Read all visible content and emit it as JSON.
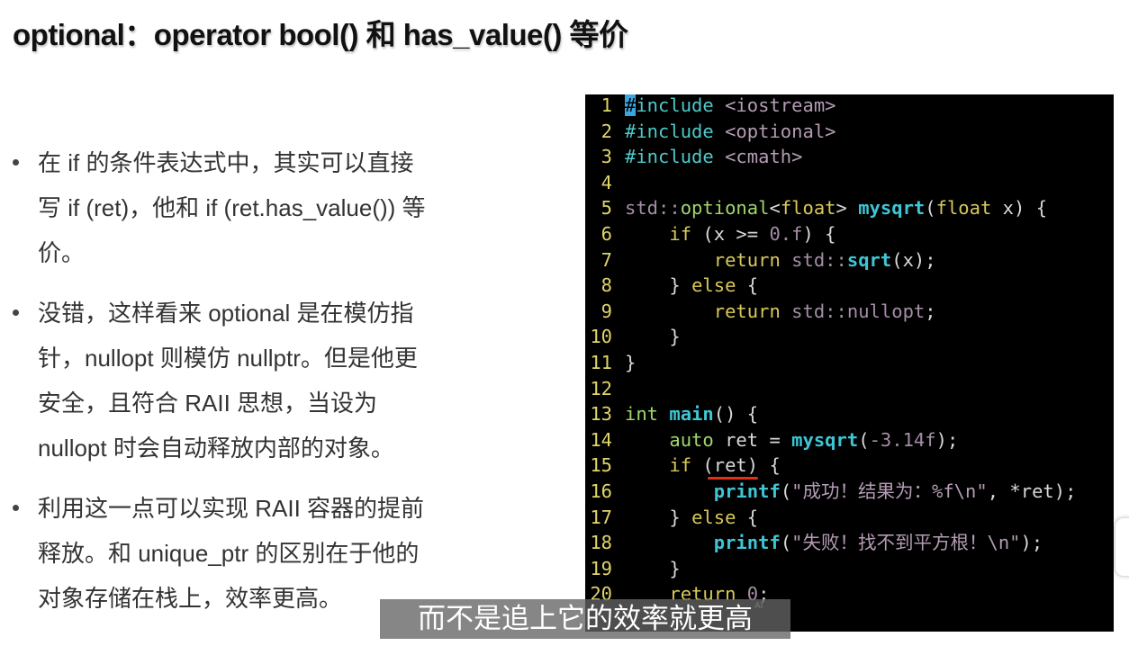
{
  "slide": {
    "title": "optional：operator bool() 和 has_value() 等价",
    "bullets": [
      {
        "lines": [
          "在 if 的条件表达式中，其实可以直接",
          "写 if (ret)，他和 if (ret.has_value()) 等",
          "价。"
        ]
      },
      {
        "lines": [
          "没错，这样看来 optional 是在模仿指",
          "针，nullopt 则模仿 nullptr。但是他更",
          "安全，且符合 RAII 思想，当设为",
          "nullopt 时会自动释放内部的对象。"
        ]
      },
      {
        "lines": [
          "利用这一点可以实现 RAII 容器的提前",
          "释放。和 unique_ptr 的区别在于他的",
          "对象存储在栈上，效率更高。"
        ]
      }
    ]
  },
  "code": {
    "lines": [
      {
        "n": "1",
        "t": [
          [
            "cursor",
            "#"
          ],
          [
            "pp",
            "include "
          ],
          [
            "inc",
            "<iostream>"
          ]
        ]
      },
      {
        "n": "2",
        "t": [
          [
            "pp",
            "#include "
          ],
          [
            "inc",
            "<optional>"
          ]
        ]
      },
      {
        "n": "3",
        "t": [
          [
            "pp",
            "#include "
          ],
          [
            "inc",
            "<cmath>"
          ]
        ]
      },
      {
        "n": "4",
        "t": []
      },
      {
        "n": "5",
        "t": [
          [
            "std",
            "std::"
          ],
          [
            "ty",
            "optional"
          ],
          [
            "pl",
            "<"
          ],
          [
            "kw",
            "float"
          ],
          [
            "pl",
            "> "
          ],
          [
            "fn",
            "mysqrt"
          ],
          [
            "pl",
            "("
          ],
          [
            "kw",
            "float"
          ],
          [
            "pl",
            " x) {"
          ]
        ]
      },
      {
        "n": "6",
        "t": [
          [
            "pl",
            "    "
          ],
          [
            "kw",
            "if"
          ],
          [
            "pl",
            " (x >= "
          ],
          [
            "num",
            "0.f"
          ],
          [
            "pl",
            ") {"
          ]
        ]
      },
      {
        "n": "7",
        "t": [
          [
            "pl",
            "        "
          ],
          [
            "kw",
            "return"
          ],
          [
            "std",
            " std::"
          ],
          [
            "fn",
            "sqrt"
          ],
          [
            "pl",
            "(x);"
          ]
        ]
      },
      {
        "n": "8",
        "t": [
          [
            "pl",
            "    } "
          ],
          [
            "kw",
            "else"
          ],
          [
            "pl",
            " {"
          ]
        ]
      },
      {
        "n": "9",
        "t": [
          [
            "pl",
            "        "
          ],
          [
            "kw",
            "return"
          ],
          [
            "std",
            " std::nullopt"
          ],
          [
            "pl",
            ";"
          ]
        ]
      },
      {
        "n": "10",
        "t": [
          [
            "pl",
            "    }"
          ]
        ]
      },
      {
        "n": "11",
        "t": [
          [
            "pl",
            "}"
          ]
        ]
      },
      {
        "n": "12",
        "t": []
      },
      {
        "n": "13",
        "t": [
          [
            "ty",
            "int"
          ],
          [
            "pl",
            " "
          ],
          [
            "fn",
            "main"
          ],
          [
            "pl",
            "() {"
          ]
        ]
      },
      {
        "n": "14",
        "t": [
          [
            "pl",
            "    "
          ],
          [
            "ty",
            "auto"
          ],
          [
            "pl",
            " ret = "
          ],
          [
            "fn",
            "mysqrt"
          ],
          [
            "pl",
            "("
          ],
          [
            "num",
            "-3.14f"
          ],
          [
            "pl",
            ");"
          ]
        ]
      },
      {
        "n": "15",
        "t": [
          [
            "pl",
            "    "
          ],
          [
            "kw",
            "if"
          ],
          [
            "pl",
            " (ret) {"
          ]
        ]
      },
      {
        "n": "16",
        "t": [
          [
            "pl",
            "        "
          ],
          [
            "fn",
            "printf"
          ],
          [
            "pl",
            "("
          ],
          [
            "str",
            "\"成功！结果为：%f\\n\""
          ],
          [
            "pl",
            ", *ret);"
          ]
        ]
      },
      {
        "n": "17",
        "t": [
          [
            "pl",
            "    } "
          ],
          [
            "kw",
            "else"
          ],
          [
            "pl",
            " {"
          ]
        ]
      },
      {
        "n": "18",
        "t": [
          [
            "pl",
            "        "
          ],
          [
            "fn",
            "printf"
          ],
          [
            "pl",
            "("
          ],
          [
            "str",
            "\"失败！找不到平方根！\\n\""
          ],
          [
            "pl",
            ");"
          ]
        ]
      },
      {
        "n": "19",
        "t": [
          [
            "pl",
            "    }"
          ]
        ]
      },
      {
        "n": "20",
        "t": [
          [
            "pl",
            "    "
          ],
          [
            "kw",
            "return"
          ],
          [
            "pl",
            " "
          ],
          [
            "num",
            "0"
          ],
          [
            "pl",
            ";"
          ]
        ]
      }
    ]
  },
  "subtitle": {
    "text": "而不是追上它的效率就更高",
    "badge": "AI"
  },
  "colors": {
    "code_bg": "#000000",
    "line_number": "#e0d56a",
    "function": "#3ec6d6",
    "keyword": "#d8c95a",
    "underline": "#e0301a"
  }
}
